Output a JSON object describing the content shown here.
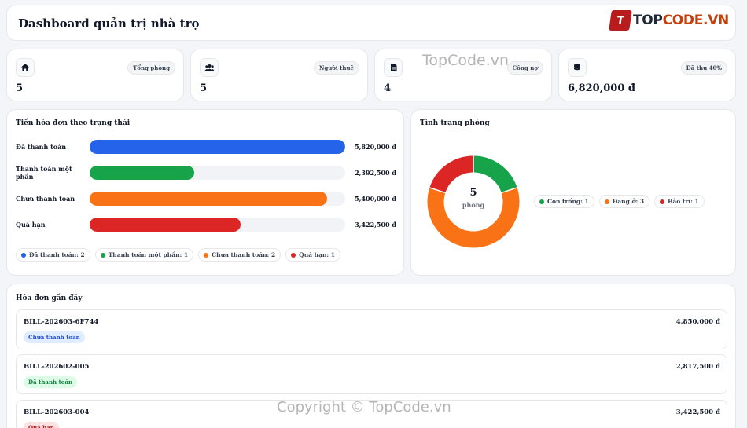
{
  "header": {
    "title": "Dashboard quản trị nhà trọ",
    "logo_mark": "T",
    "logo_text_a": "TOP",
    "logo_text_b": "CODE.VN"
  },
  "stats": [
    {
      "icon": "home-icon",
      "badge": "Tổng phòng",
      "value": "5"
    },
    {
      "icon": "users-icon",
      "badge": "Người thuê",
      "value": "5"
    },
    {
      "icon": "document-icon",
      "badge": "Công nợ",
      "value": "4"
    },
    {
      "icon": "coins-icon",
      "badge": "Đã thu 40%",
      "value": "6,820,000 đ"
    }
  ],
  "invoice_status": {
    "title": "Tiền hóa đơn theo trạng thái",
    "rows": [
      {
        "label": "Đã thanh toán",
        "amount": "5,820,000 đ",
        "fill": 1.0,
        "color": "#2563eb"
      },
      {
        "label": "Thanh toán một phần",
        "amount": "2,392,500 đ",
        "fill": 0.41,
        "color": "#16a34a"
      },
      {
        "label": "Chưa thanh toán",
        "amount": "5,400,000 đ",
        "fill": 0.93,
        "color": "#f97316"
      },
      {
        "label": "Quá hạn",
        "amount": "3,422,500 đ",
        "fill": 0.59,
        "color": "#dc2626"
      }
    ],
    "legend": [
      {
        "label": "Đã thanh toán: 2",
        "color": "#2563eb"
      },
      {
        "label": "Thanh toán một phần: 1",
        "color": "#16a34a"
      },
      {
        "label": "Chưa thanh toán: 2",
        "color": "#f97316"
      },
      {
        "label": "Quá hạn: 1",
        "color": "#dc2626"
      }
    ]
  },
  "room_status": {
    "title": "Tình trạng phòng",
    "total": "5",
    "unit": "phòng",
    "segments": [
      {
        "label": "Còn trống: 1",
        "count": 1,
        "color": "#16a34a"
      },
      {
        "label": "Đang ở: 3",
        "count": 3,
        "color": "#f97316"
      },
      {
        "label": "Bảo trì: 1",
        "count": 1,
        "color": "#dc2626"
      }
    ]
  },
  "recent_bills": {
    "title": "Hóa đơn gần đây",
    "items": [
      {
        "code": "BILL-202603-6F744",
        "amount": "4,850,000 đ",
        "status": "Chưa thanh toán",
        "status_color": "#1d4ed8",
        "status_bg": "#e0ecff"
      },
      {
        "code": "BILL-202602-005",
        "amount": "2,817,500 đ",
        "status": "Đã thanh toán",
        "status_color": "#15803d",
        "status_bg": "#dcfce7"
      },
      {
        "code": "BILL-202603-004",
        "amount": "3,422,500 đ",
        "status": "Quá hạn",
        "status_color": "#b91c1c",
        "status_bg": "#fee2e2"
      }
    ]
  },
  "watermarks": {
    "top": "TopCode.vn",
    "bottom": "Copyright © TopCode.vn"
  }
}
